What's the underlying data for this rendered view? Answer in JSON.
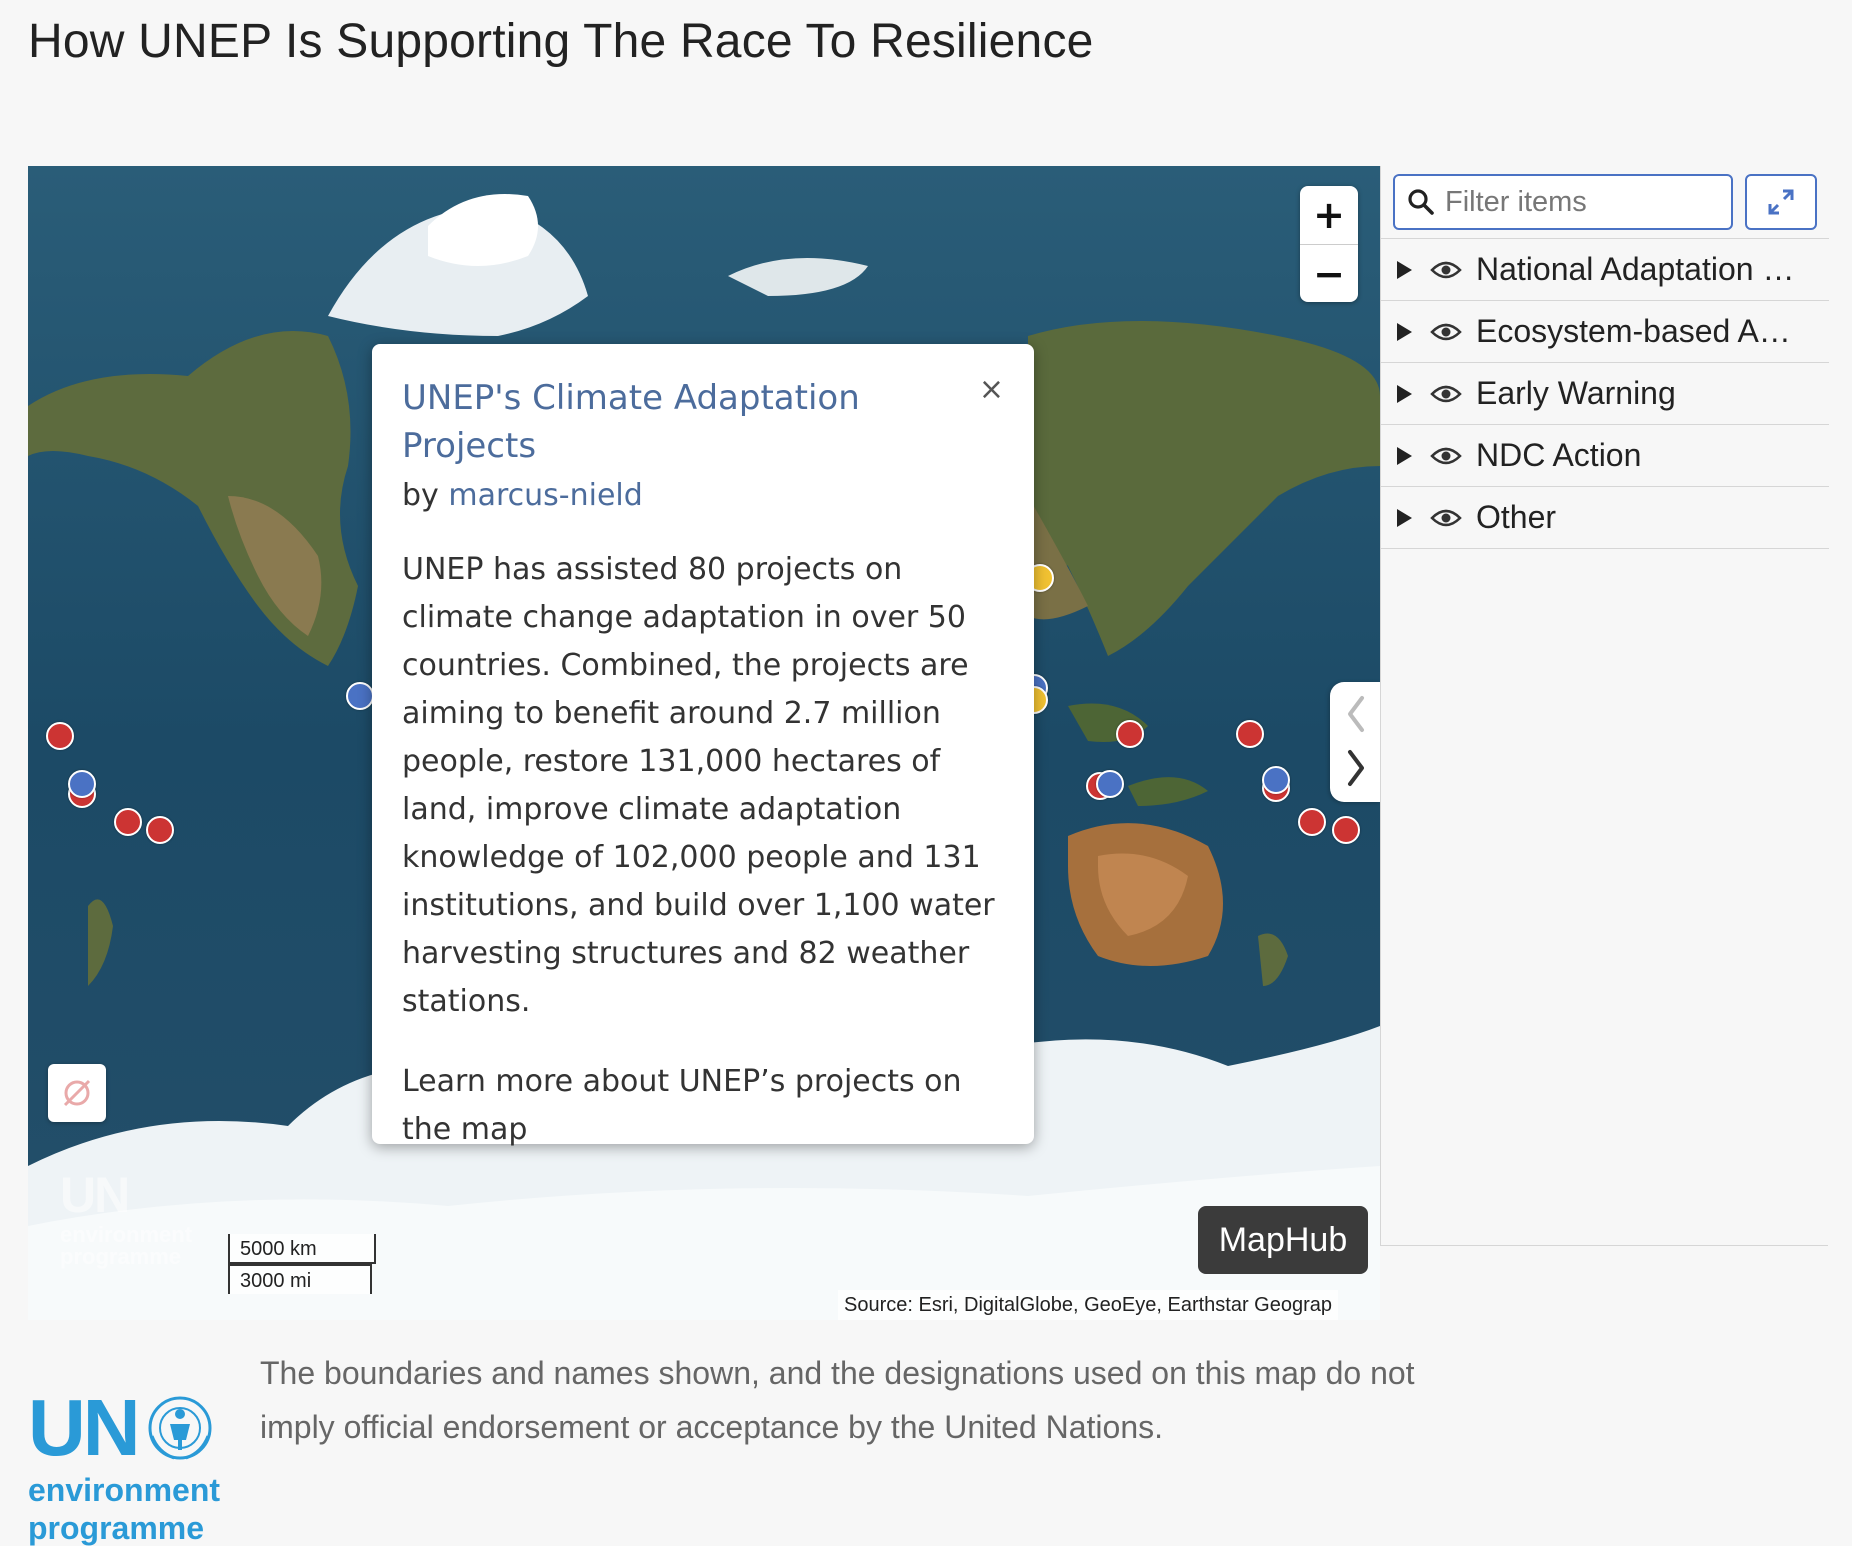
{
  "page": {
    "title": "How UNEP Is Supporting The Race To Resilience"
  },
  "map": {
    "zoom_in_label": "+",
    "zoom_out_label": "−",
    "scale_km": "5000 km",
    "scale_mi": "3000 mi",
    "maphub_label": "MapHub",
    "attribution": "Source: Esri, DigitalGlobe, GeoEye, Earthstar Geograp",
    "watermark": {
      "un": "UN",
      "line1": "environment",
      "line2": "programme"
    },
    "marker_colors": {
      "red": "#cc3433",
      "blue": "#4a72c4",
      "yellow": "#f1c232"
    }
  },
  "popup": {
    "title": "UNEP's Climate Adaptation Projects",
    "by_prefix": "by",
    "author": "marcus-nield",
    "body": "UNEP has assisted 80 projects on climate change adaptation in over 50 countries. Combined, the projects are aiming to benefit around 2.7 million people, restore 131,000 hectares of land, improve climate adaptation knowledge of 102,000 people and 131 institutions, and build over 1,100 water harvesting structures and 82 weather stations.",
    "more": "Learn more about UNEP’s projects on the map",
    "close_label": "×"
  },
  "panel": {
    "filter_placeholder": "Filter items",
    "layers": [
      {
        "label": "National Adaptation …"
      },
      {
        "label": "Ecosystem-based A…"
      },
      {
        "label": "Early Warning"
      },
      {
        "label": "NDC Action"
      },
      {
        "label": "Other"
      }
    ]
  },
  "footer": {
    "logo_un": "UN",
    "logo_line1": "environment",
    "logo_line2": "programme",
    "disclaimer": "The boundaries and names shown, and the designations used on this map do not imply official endorsement or acceptance by the United Nations."
  },
  "colors": {
    "accent": "#4a72c4",
    "link": "#4c6c9c",
    "un_blue": "#2a9ad7",
    "ocean": "#1d4d68"
  }
}
